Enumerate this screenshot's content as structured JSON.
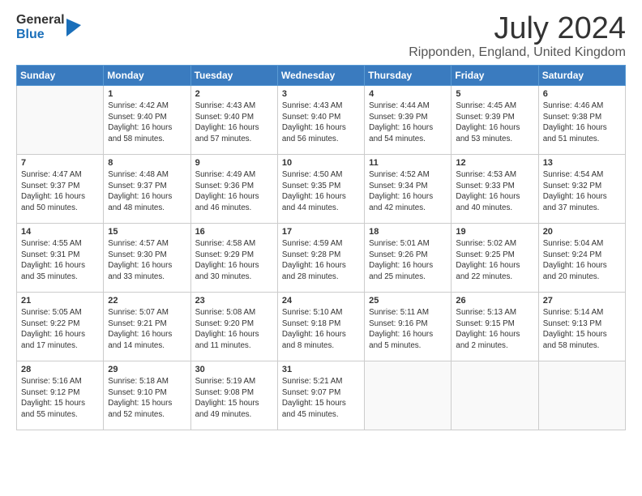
{
  "logo": {
    "general": "General",
    "blue": "Blue"
  },
  "title": "July 2024",
  "subtitle": "Ripponden, England, United Kingdom",
  "weekdays": [
    "Sunday",
    "Monday",
    "Tuesday",
    "Wednesday",
    "Thursday",
    "Friday",
    "Saturday"
  ],
  "weeks": [
    [
      {
        "day": "",
        "info": ""
      },
      {
        "day": "1",
        "info": "Sunrise: 4:42 AM\nSunset: 9:40 PM\nDaylight: 16 hours\nand 58 minutes."
      },
      {
        "day": "2",
        "info": "Sunrise: 4:43 AM\nSunset: 9:40 PM\nDaylight: 16 hours\nand 57 minutes."
      },
      {
        "day": "3",
        "info": "Sunrise: 4:43 AM\nSunset: 9:40 PM\nDaylight: 16 hours\nand 56 minutes."
      },
      {
        "day": "4",
        "info": "Sunrise: 4:44 AM\nSunset: 9:39 PM\nDaylight: 16 hours\nand 54 minutes."
      },
      {
        "day": "5",
        "info": "Sunrise: 4:45 AM\nSunset: 9:39 PM\nDaylight: 16 hours\nand 53 minutes."
      },
      {
        "day": "6",
        "info": "Sunrise: 4:46 AM\nSunset: 9:38 PM\nDaylight: 16 hours\nand 51 minutes."
      }
    ],
    [
      {
        "day": "7",
        "info": "Sunrise: 4:47 AM\nSunset: 9:37 PM\nDaylight: 16 hours\nand 50 minutes."
      },
      {
        "day": "8",
        "info": "Sunrise: 4:48 AM\nSunset: 9:37 PM\nDaylight: 16 hours\nand 48 minutes."
      },
      {
        "day": "9",
        "info": "Sunrise: 4:49 AM\nSunset: 9:36 PM\nDaylight: 16 hours\nand 46 minutes."
      },
      {
        "day": "10",
        "info": "Sunrise: 4:50 AM\nSunset: 9:35 PM\nDaylight: 16 hours\nand 44 minutes."
      },
      {
        "day": "11",
        "info": "Sunrise: 4:52 AM\nSunset: 9:34 PM\nDaylight: 16 hours\nand 42 minutes."
      },
      {
        "day": "12",
        "info": "Sunrise: 4:53 AM\nSunset: 9:33 PM\nDaylight: 16 hours\nand 40 minutes."
      },
      {
        "day": "13",
        "info": "Sunrise: 4:54 AM\nSunset: 9:32 PM\nDaylight: 16 hours\nand 37 minutes."
      }
    ],
    [
      {
        "day": "14",
        "info": "Sunrise: 4:55 AM\nSunset: 9:31 PM\nDaylight: 16 hours\nand 35 minutes."
      },
      {
        "day": "15",
        "info": "Sunrise: 4:57 AM\nSunset: 9:30 PM\nDaylight: 16 hours\nand 33 minutes."
      },
      {
        "day": "16",
        "info": "Sunrise: 4:58 AM\nSunset: 9:29 PM\nDaylight: 16 hours\nand 30 minutes."
      },
      {
        "day": "17",
        "info": "Sunrise: 4:59 AM\nSunset: 9:28 PM\nDaylight: 16 hours\nand 28 minutes."
      },
      {
        "day": "18",
        "info": "Sunrise: 5:01 AM\nSunset: 9:26 PM\nDaylight: 16 hours\nand 25 minutes."
      },
      {
        "day": "19",
        "info": "Sunrise: 5:02 AM\nSunset: 9:25 PM\nDaylight: 16 hours\nand 22 minutes."
      },
      {
        "day": "20",
        "info": "Sunrise: 5:04 AM\nSunset: 9:24 PM\nDaylight: 16 hours\nand 20 minutes."
      }
    ],
    [
      {
        "day": "21",
        "info": "Sunrise: 5:05 AM\nSunset: 9:22 PM\nDaylight: 16 hours\nand 17 minutes."
      },
      {
        "day": "22",
        "info": "Sunrise: 5:07 AM\nSunset: 9:21 PM\nDaylight: 16 hours\nand 14 minutes."
      },
      {
        "day": "23",
        "info": "Sunrise: 5:08 AM\nSunset: 9:20 PM\nDaylight: 16 hours\nand 11 minutes."
      },
      {
        "day": "24",
        "info": "Sunrise: 5:10 AM\nSunset: 9:18 PM\nDaylight: 16 hours\nand 8 minutes."
      },
      {
        "day": "25",
        "info": "Sunrise: 5:11 AM\nSunset: 9:16 PM\nDaylight: 16 hours\nand 5 minutes."
      },
      {
        "day": "26",
        "info": "Sunrise: 5:13 AM\nSunset: 9:15 PM\nDaylight: 16 hours\nand 2 minutes."
      },
      {
        "day": "27",
        "info": "Sunrise: 5:14 AM\nSunset: 9:13 PM\nDaylight: 15 hours\nand 58 minutes."
      }
    ],
    [
      {
        "day": "28",
        "info": "Sunrise: 5:16 AM\nSunset: 9:12 PM\nDaylight: 15 hours\nand 55 minutes."
      },
      {
        "day": "29",
        "info": "Sunrise: 5:18 AM\nSunset: 9:10 PM\nDaylight: 15 hours\nand 52 minutes."
      },
      {
        "day": "30",
        "info": "Sunrise: 5:19 AM\nSunset: 9:08 PM\nDaylight: 15 hours\nand 49 minutes."
      },
      {
        "day": "31",
        "info": "Sunrise: 5:21 AM\nSunset: 9:07 PM\nDaylight: 15 hours\nand 45 minutes."
      },
      {
        "day": "",
        "info": ""
      },
      {
        "day": "",
        "info": ""
      },
      {
        "day": "",
        "info": ""
      }
    ]
  ]
}
